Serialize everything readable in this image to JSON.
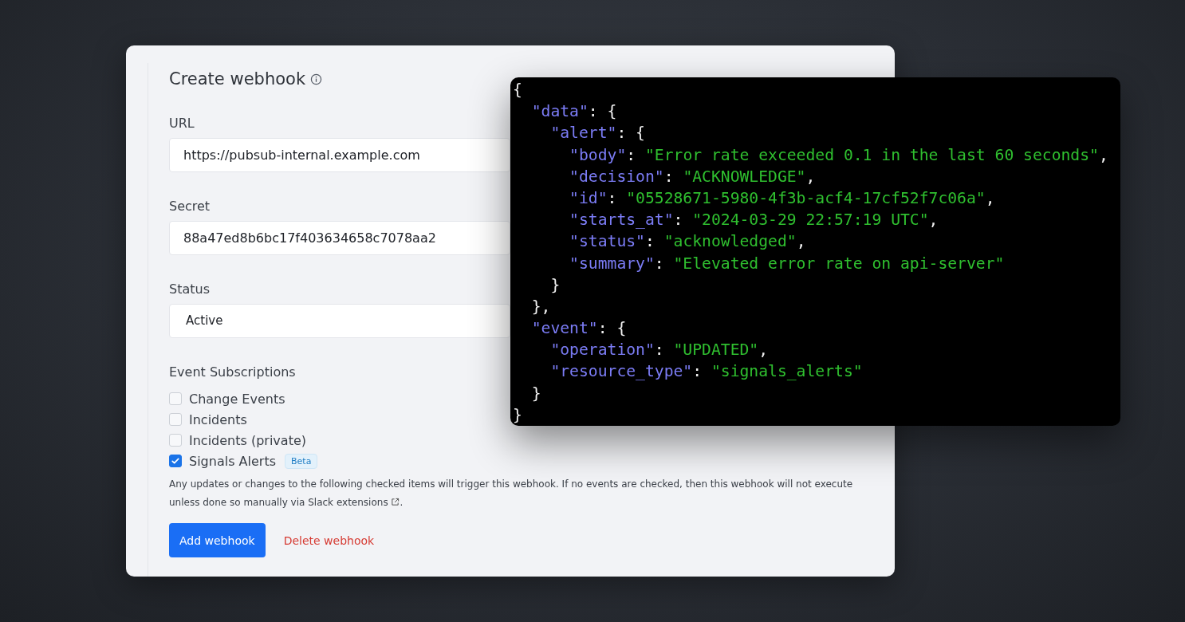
{
  "form": {
    "title": "Create webhook",
    "fields": [
      {
        "label": "URL",
        "value": "https://pubsub-internal.example.com",
        "kind": "text"
      },
      {
        "label": "Secret",
        "value": "88a47ed8b6bc17f403634658c7078aa2",
        "kind": "text"
      },
      {
        "label": "Status",
        "value": "Active",
        "kind": "select"
      }
    ],
    "subscriptions": {
      "label": "Event Subscriptions",
      "items": [
        {
          "label": "Change Events",
          "checked": false
        },
        {
          "label": "Incidents",
          "checked": false
        },
        {
          "label": "Incidents (private)",
          "checked": false
        },
        {
          "label": "Signals Alerts",
          "checked": true,
          "badge": "Beta"
        }
      ]
    },
    "help_text": "Any updates or changes to the following checked items will trigger this webhook. If no events are checked, then this webhook will not execute unless done so manually via",
    "help_link": "Slack extensions",
    "help_end": ".",
    "buttons": [
      {
        "label": "Add webhook",
        "kind": "primary"
      },
      {
        "label": "Delete webhook",
        "kind": "danger"
      }
    ]
  },
  "code_panel": {
    "lines": [
      [
        {
          "kind": "punct",
          "text": "{"
        }
      ],
      [
        {
          "kind": "key",
          "text": "  \"data\""
        },
        {
          "kind": "punct",
          "text": ": {"
        }
      ],
      [
        {
          "kind": "key",
          "text": "    \"alert\""
        },
        {
          "kind": "punct",
          "text": ": {"
        }
      ],
      [
        {
          "kind": "key",
          "text": "      \"body\""
        },
        {
          "kind": "punct",
          "text": ": "
        },
        {
          "kind": "string",
          "text": "\"Error rate exceeded 0.1 in the last 60 seconds\""
        },
        {
          "kind": "punct",
          "text": ","
        }
      ],
      [
        {
          "kind": "key",
          "text": "      \"decision\""
        },
        {
          "kind": "punct",
          "text": ": "
        },
        {
          "kind": "string",
          "text": "\"ACKNOWLEDGE\""
        },
        {
          "kind": "punct",
          "text": ","
        }
      ],
      [
        {
          "kind": "key",
          "text": "      \"id\""
        },
        {
          "kind": "punct",
          "text": ": "
        },
        {
          "kind": "string",
          "text": "\"05528671-5980-4f3b-acf4-17cf52f7c06a\""
        },
        {
          "kind": "punct",
          "text": ","
        }
      ],
      [
        {
          "kind": "key",
          "text": "      \"starts_at\""
        },
        {
          "kind": "punct",
          "text": ": "
        },
        {
          "kind": "string",
          "text": "\"2024-03-29 22:57:19 UTC\""
        },
        {
          "kind": "punct",
          "text": ","
        }
      ],
      [
        {
          "kind": "key",
          "text": "      \"status\""
        },
        {
          "kind": "punct",
          "text": ": "
        },
        {
          "kind": "string",
          "text": "\"acknowledged\""
        },
        {
          "kind": "punct",
          "text": ","
        }
      ],
      [
        {
          "kind": "key",
          "text": "      \"summary\""
        },
        {
          "kind": "punct",
          "text": ": "
        },
        {
          "kind": "string",
          "text": "\"Elevated error rate on api-server\""
        }
      ],
      [
        {
          "kind": "punct",
          "text": "    }"
        }
      ],
      [
        {
          "kind": "punct",
          "text": "  },"
        }
      ],
      [
        {
          "kind": "key",
          "text": "  \"event\""
        },
        {
          "kind": "punct",
          "text": ": {"
        }
      ],
      [
        {
          "kind": "key",
          "text": "    \"operation\""
        },
        {
          "kind": "punct",
          "text": ": "
        },
        {
          "kind": "string",
          "text": "\"UPDATED\""
        },
        {
          "kind": "punct",
          "text": ","
        }
      ],
      [
        {
          "kind": "key",
          "text": "    \"resource_type\""
        },
        {
          "kind": "punct",
          "text": ": "
        },
        {
          "kind": "string",
          "text": "\"signals_alerts\""
        }
      ],
      [
        {
          "kind": "punct",
          "text": "  }"
        }
      ],
      [
        {
          "kind": "punct",
          "text": "}"
        }
      ]
    ]
  }
}
